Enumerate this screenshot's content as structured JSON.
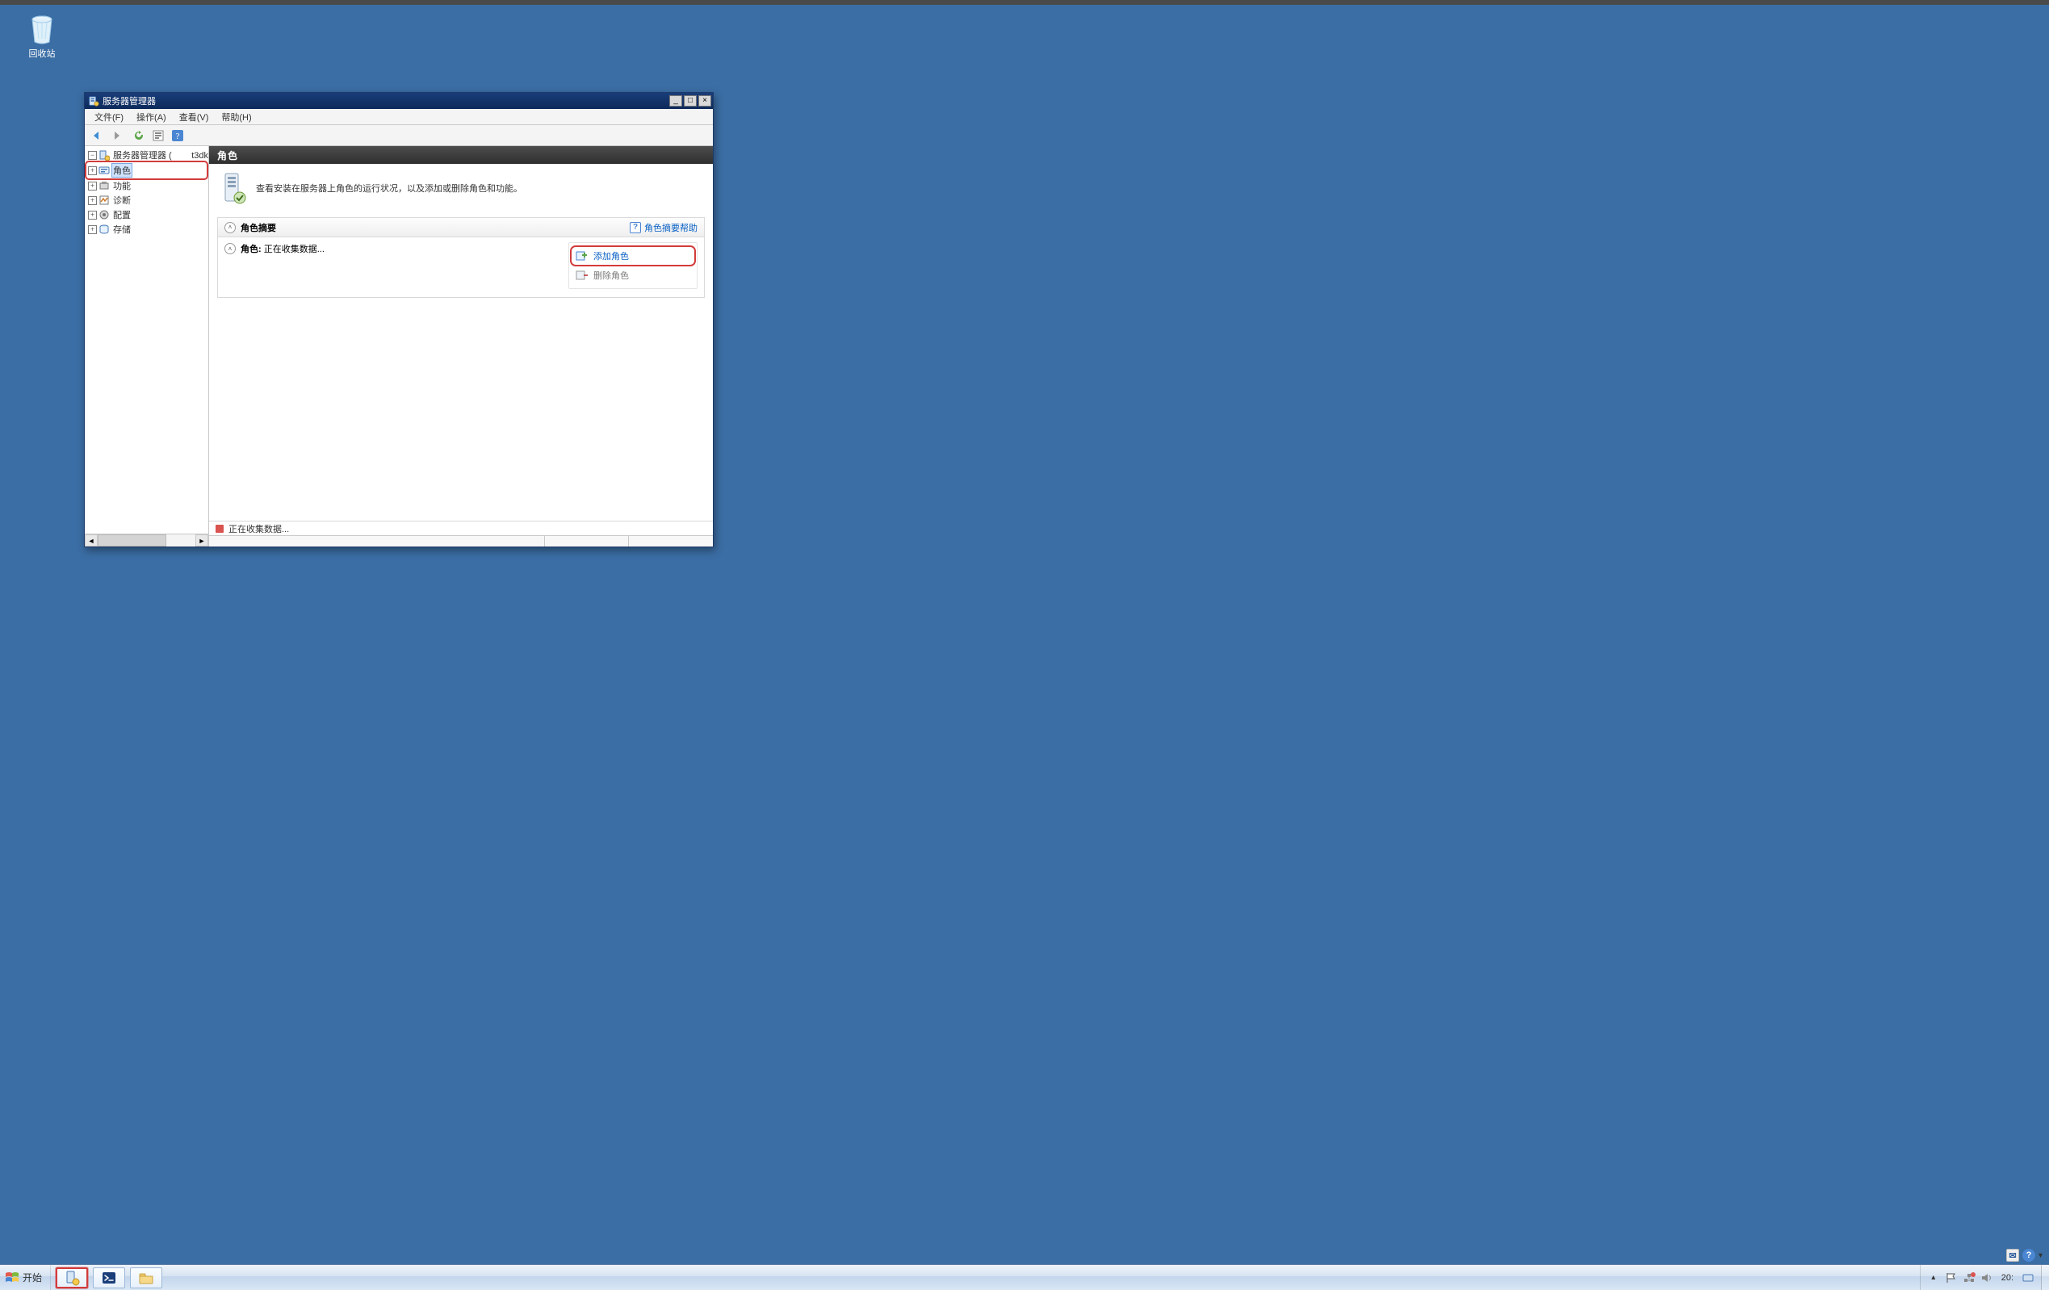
{
  "desktop": {
    "recycle_bin_label": "回收站"
  },
  "taskbar": {
    "start_label": "开始",
    "time": "20:"
  },
  "mini": {
    "help": "?"
  },
  "window": {
    "title": "服务器管理器",
    "menu": {
      "file": "文件(F)",
      "action": "操作(A)",
      "view": "查看(V)",
      "help": "帮助(H)"
    },
    "tree": {
      "root": "服务器管理器 (",
      "root_suffix": "t3dk",
      "roles": "角色",
      "features": "功能",
      "diagnostics": "诊断",
      "config": "配置",
      "storage": "存储"
    },
    "content": {
      "header": "角色",
      "desc": "查看安装在服务器上角色的运行状况，以及添加或删除角色和功能。",
      "summary_title": "角色摘要",
      "help_link": "角色摘要帮助",
      "roles_label": "角色:",
      "collecting": "正在收集数据...",
      "add_role": "添加角色",
      "remove_role": "删除角色",
      "status": "正在收集数据..."
    }
  }
}
